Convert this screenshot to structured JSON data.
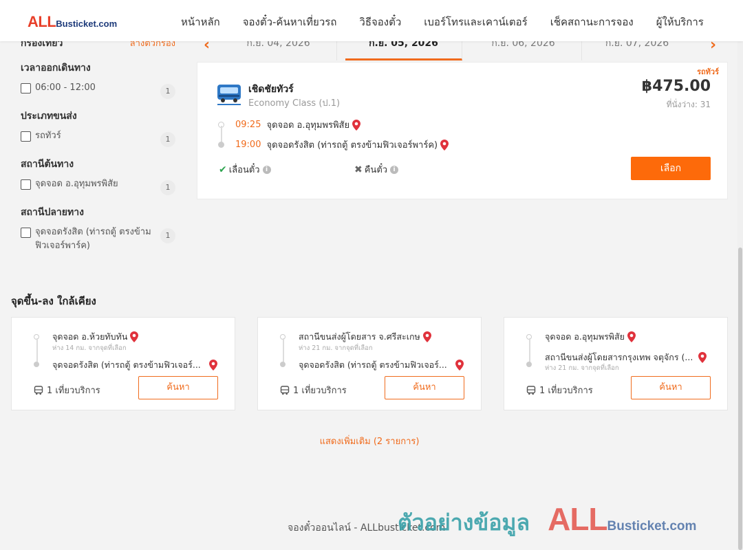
{
  "header": {
    "logo_all": "ALL",
    "logo_rest": "Busticket.com",
    "nav": [
      "หน้าหลัก",
      "จองตั๋ว-ค้นหาเที่ยวรถ",
      "วิธีจองตั๋ว",
      "เบอร์โทรและเคาน์เตอร์",
      "เช็คสถานะการจอง",
      "ผู้ให้บริการ"
    ]
  },
  "sidebar": {
    "title": "กรองเที่ยว",
    "clear": "ล้างตัวกรอง",
    "groups": [
      {
        "title": "เวลาออกเดินทาง",
        "option": "06:00 - 12:00",
        "count": "1"
      },
      {
        "title": "ประเภทขนส่ง",
        "option": "รถทัวร์",
        "count": "1"
      },
      {
        "title": "สถานีต้นทาง",
        "option": "จุดจอด อ.อุทุมพรพิสัย",
        "count": "1"
      },
      {
        "title": "สถานีปลายทาง",
        "option": "จุดจอดรังสิต (ท่ารถตู้ ตรงข้ามฟิวเจอร์พาร์ค)",
        "count": "1"
      }
    ]
  },
  "dates": {
    "tabs": [
      "ก.ย. 04, 2026",
      "ก.ย. 05, 2026",
      "ก.ย. 06, 2026",
      "ก.ย. 07, 2026"
    ],
    "active_index": 1,
    "prev_icon": "chevron-left-icon",
    "next_icon": "chevron-right-icon"
  },
  "trip": {
    "bus_type": "รถทัวร์",
    "operator_name": "เชิดชัยทัวร์",
    "operator_class": "Economy Class (ป.1)",
    "price": "฿475.00",
    "seats": "ที่นั่งว่าง: 31",
    "depart_time": "09:25",
    "depart_stop": "จุดจอด อ.อุทุมพรพิสัย",
    "arrive_time": "19:00",
    "arrive_stop": "จุดจอดรังสิต (ท่ารถตู้ ตรงข้ามฟิวเจอร์พาร์ค)",
    "reschedule": "เลื่อนตั๋ว",
    "refund": "คืนตั๋ว",
    "select_label": "เลือก"
  },
  "nearby": {
    "title": "จุดขึ้น-ลง ใกล้เคียง",
    "cards": [
      {
        "from": "จุดจอด อ.ห้วยทับทัน",
        "from_dist": "ห่าง 14 กม. จากจุดที่เลือก",
        "to": "จุดจอดรังสิต (ท่ารถตู้ ตรงข้ามฟิวเจอร์...",
        "to_dist": "",
        "trips": "1 เที่ยวบริการ",
        "btn": "ค้นหา"
      },
      {
        "from": "สถานีขนส่งผู้โดยสาร จ.ศรีสะเกษ",
        "from_dist": "ห่าง 21 กม. จากจุดที่เลือก",
        "to": "จุดจอดรังสิต (ท่ารถตู้ ตรงข้ามฟิวเจอร์...",
        "to_dist": "",
        "trips": "1 เที่ยวบริการ",
        "btn": "ค้นหา"
      },
      {
        "from": "จุดจอด อ.อุทุมพรพิสัย",
        "from_dist": "",
        "to": "สถานีขนส่งผู้โดยสารกรุงเทพ จตุจักร (...",
        "to_dist": "ห่าง 21 กม. จากจุดที่เลือก",
        "trips": "1 เที่ยวบริการ",
        "btn": "ค้นหา"
      }
    ]
  },
  "show_more": "แสดงเพิ่มเติม (2 รายการ)",
  "footer": "จองตั๋วออนไลน์ - ALLbusticket.com",
  "watermark": {
    "thai": "ตัวอย่างข้อมูล",
    "all": "ALL",
    "rest": "Busticket.com"
  },
  "colors": {
    "accent": "#f06b1c",
    "button": "#fd6a0a",
    "pin": "#e0323c"
  }
}
